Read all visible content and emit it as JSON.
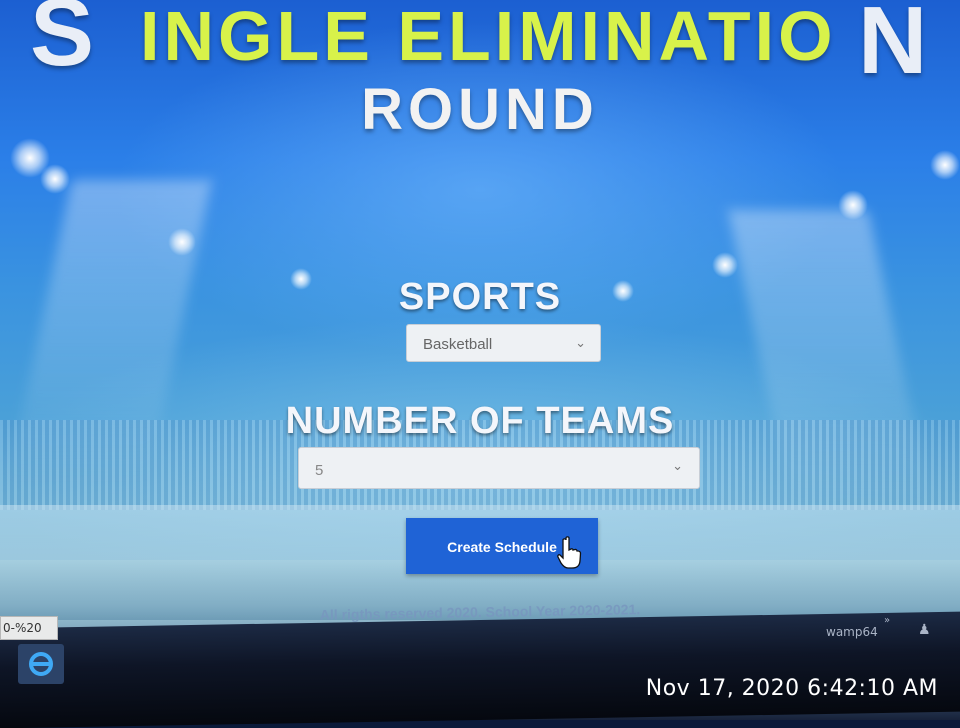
{
  "header": {
    "title_cap_left": "S",
    "title_middle": "INGLE ELIMINATIO",
    "title_cap_right": "N",
    "title_line2": "ROUND"
  },
  "form": {
    "sports_label": "SPORTS",
    "sports_value": "Basketball",
    "teams_label": "NUMBER OF TEAMS",
    "teams_value": "5",
    "create_button_label": "Create Schedule"
  },
  "footer": {
    "copyright": "All rigths reserved 2020. School Year 2020-2021."
  },
  "browser": {
    "status_text": "0-%20"
  },
  "taskbar": {
    "tray_label": "wamp64",
    "overflow_chevrons": "»"
  },
  "photo_timestamp": "Nov 17, 2020 6:42:10 AM",
  "colors": {
    "title_yellow": "#d8f24a",
    "title_white": "#f2f2f2",
    "button_blue": "#1f63d6"
  },
  "icons": [
    "chevron-down-icon",
    "hand-cursor-icon",
    "internet-explorer-icon",
    "people-icon"
  ]
}
